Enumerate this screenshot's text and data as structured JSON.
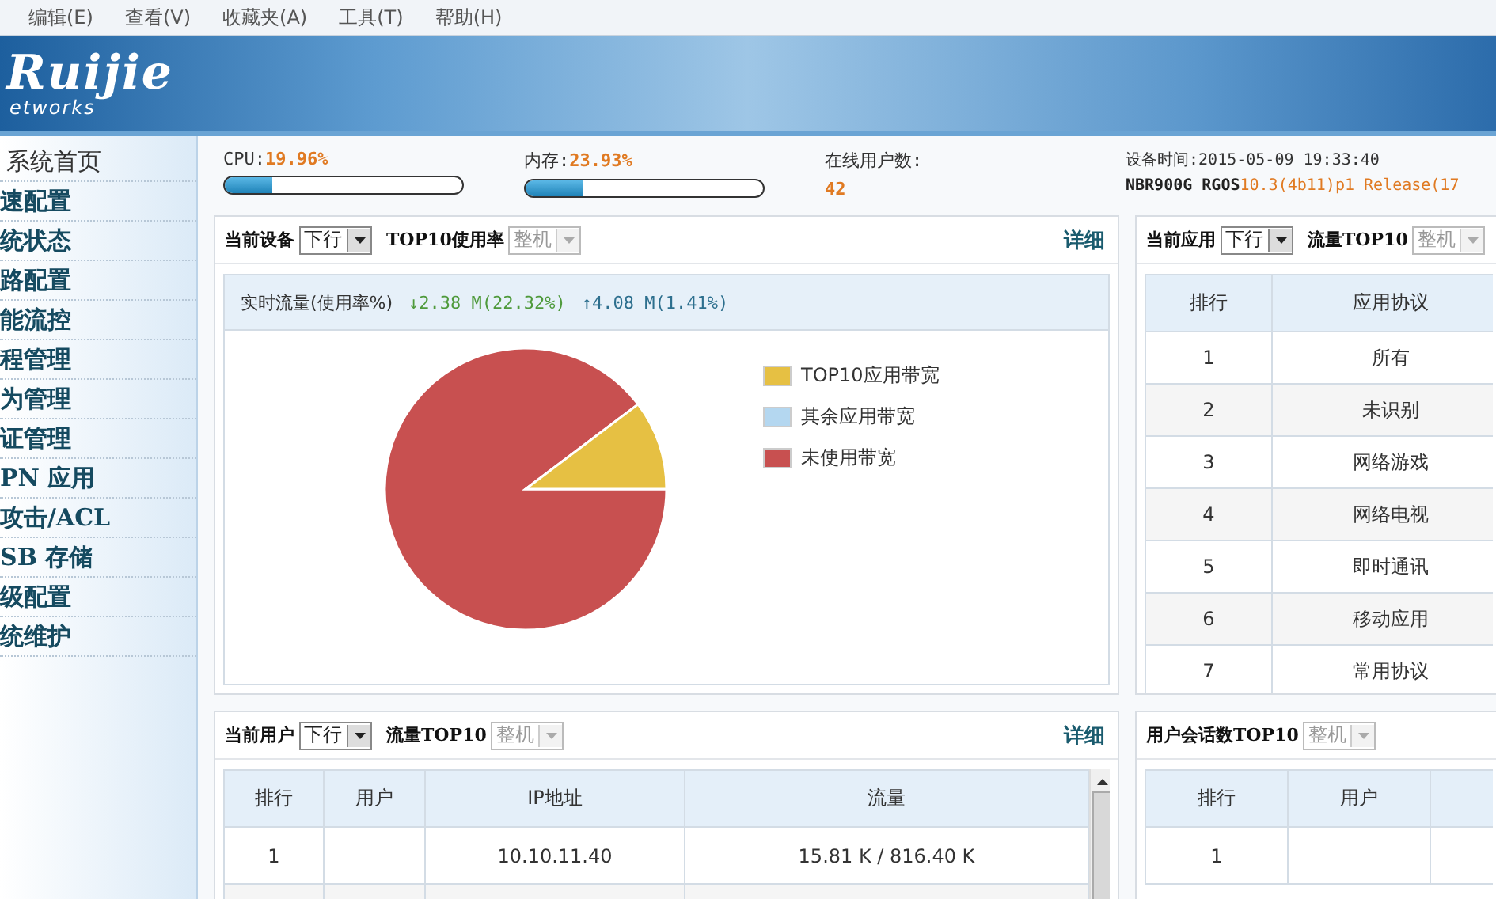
{
  "menu_bar": [
    "编辑(E)",
    "查看(V)",
    "收藏夹(A)",
    "工具(T)",
    "帮助(H)"
  ],
  "banner": {
    "logo": "Ruijie",
    "logo_sub": "etworks"
  },
  "sidebar": {
    "items": [
      {
        "label": "系统首页",
        "selected": true
      },
      {
        "label": "速配置",
        "selected": false
      },
      {
        "label": "统状态",
        "selected": false
      },
      {
        "label": "路配置",
        "selected": false
      },
      {
        "label": "能流控",
        "selected": false
      },
      {
        "label": "程管理",
        "selected": false
      },
      {
        "label": "为管理",
        "selected": false
      },
      {
        "label": "证管理",
        "selected": false
      },
      {
        "label": "PN 应用",
        "selected": false
      },
      {
        "label": "攻击/ACL",
        "selected": false
      },
      {
        "label": "SB 存储",
        "selected": false
      },
      {
        "label": "级配置",
        "selected": false
      },
      {
        "label": "统维护",
        "selected": false
      }
    ]
  },
  "stats": [
    {
      "kind": "meter",
      "label": "CPU:",
      "value": "19.96%",
      "level": 0.2
    },
    {
      "kind": "meter",
      "label": "内存:",
      "value": "23.93%",
      "level": 0.24
    },
    {
      "kind": "count",
      "label": "在线用户数:",
      "value": "42"
    },
    {
      "kind": "device",
      "label": "设备时间:",
      "value": "2015-05-09 19:33:40",
      "model": "NBR900G RGOS",
      "version": "10.3(4b11)p1 Release(17"
    }
  ],
  "device_panel": {
    "title": "当前设备",
    "direction": {
      "value": "下行",
      "disabled": false
    },
    "sub_title": "TOP10使用率",
    "scope": {
      "value": "整机",
      "disabled": true
    },
    "link": "详细",
    "traffic_label": "实时流量(使用率%)",
    "down": "↓2.38 M(22.32%)",
    "up": "↑4.08 M(1.41%)",
    "legend": [
      {
        "label": "TOP10应用带宽",
        "color": "#e6c043"
      },
      {
        "label": "其余应用带宽",
        "color": "#b4d7f0"
      },
      {
        "label": "未使用带宽",
        "color": "#c85050"
      }
    ]
  },
  "app_panel": {
    "title": "当前应用",
    "direction": {
      "value": "下行",
      "disabled": false
    },
    "sub_title": "流量TOP10",
    "scope": {
      "value": "整机",
      "disabled": true
    },
    "columns": [
      "排行",
      "应用协议"
    ],
    "rows": [
      [
        "1",
        "所有"
      ],
      [
        "2",
        "未识别"
      ],
      [
        "3",
        "网络游戏"
      ],
      [
        "4",
        "网络电视"
      ],
      [
        "5",
        "即时通讯"
      ],
      [
        "6",
        "移动应用"
      ],
      [
        "7",
        "常用协议"
      ]
    ]
  },
  "user_panel": {
    "title": "当前用户",
    "direction": {
      "value": "下行",
      "disabled": false
    },
    "sub_title": "流量TOP10",
    "scope": {
      "value": "整机",
      "disabled": true
    },
    "link": "详细",
    "columns": [
      "排行",
      "用户",
      "IP地址",
      "流量"
    ],
    "rows": [
      [
        "1",
        "",
        "10.10.11.40",
        "15.81 K / 816.40 K"
      ]
    ]
  },
  "session_panel": {
    "sub_title": "用户会话数TOP10",
    "scope": {
      "value": "整机",
      "disabled": true
    },
    "columns": [
      "排行",
      "用户",
      ""
    ],
    "rows": [
      [
        "1",
        "",
        ""
      ]
    ]
  }
}
